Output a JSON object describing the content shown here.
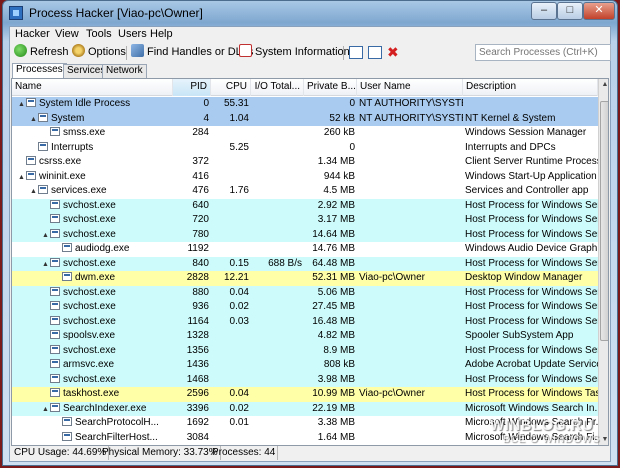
{
  "window": {
    "title": "Process Hacker [Viao-pc\\Owner]",
    "min_label": "–",
    "max_label": "□",
    "close_label": "✕"
  },
  "menu": [
    "Hacker",
    "View",
    "Tools",
    "Users",
    "Help"
  ],
  "toolbar": {
    "refresh": "Refresh",
    "options": "Options",
    "find_handles": "Find Handles or DLLs",
    "system_info": "System Information",
    "search_placeholder": "Search Processes (Ctrl+K)"
  },
  "tabs": [
    "Processes",
    "Services",
    "Network"
  ],
  "columns": [
    "Name",
    "PID",
    "CPU",
    "I/O Total...",
    "Private B...",
    "User Name",
    "Description"
  ],
  "colors": {
    "system_row": "#a9cbef",
    "service_row": "#cdfbfb",
    "own_process_row": "#ffffa8",
    "normal_row": "#ffffff"
  },
  "processes": [
    {
      "name": "System Idle Process",
      "pid": "0",
      "cpu": "55.31",
      "io": "",
      "private": "0",
      "user": "NT AUTHORITY\\SYSTEM",
      "desc": "",
      "depth": 0,
      "toggle": "▲",
      "kind": "system"
    },
    {
      "name": "System",
      "pid": "4",
      "cpu": "1.04",
      "io": "",
      "private": "52 kB",
      "user": "NT AUTHORITY\\SYSTEM",
      "desc": "NT Kernel & System",
      "depth": 1,
      "toggle": "▲",
      "kind": "system"
    },
    {
      "name": "smss.exe",
      "pid": "284",
      "cpu": "",
      "io": "",
      "private": "260 kB",
      "user": "",
      "desc": "Windows Session Manager",
      "depth": 2,
      "toggle": "",
      "kind": "normal"
    },
    {
      "name": "Interrupts",
      "pid": "",
      "cpu": "5.25",
      "io": "",
      "private": "0",
      "user": "",
      "desc": "Interrupts and DPCs",
      "depth": 1,
      "toggle": "",
      "kind": "normal"
    },
    {
      "name": "csrss.exe",
      "pid": "372",
      "cpu": "",
      "io": "",
      "private": "1.34 MB",
      "user": "",
      "desc": "Client Server Runtime Process",
      "depth": 0,
      "toggle": "",
      "kind": "normal"
    },
    {
      "name": "wininit.exe",
      "pid": "416",
      "cpu": "",
      "io": "",
      "private": "944 kB",
      "user": "",
      "desc": "Windows Start-Up Application",
      "depth": 0,
      "toggle": "▲",
      "kind": "normal"
    },
    {
      "name": "services.exe",
      "pid": "476",
      "cpu": "1.76",
      "io": "",
      "private": "4.5 MB",
      "user": "",
      "desc": "Services and Controller app",
      "depth": 1,
      "toggle": "▲",
      "kind": "normal"
    },
    {
      "name": "svchost.exe",
      "pid": "640",
      "cpu": "",
      "io": "",
      "private": "2.92 MB",
      "user": "",
      "desc": "Host Process for Windows Ser...",
      "depth": 2,
      "toggle": "",
      "kind": "service"
    },
    {
      "name": "svchost.exe",
      "pid": "720",
      "cpu": "",
      "io": "",
      "private": "3.17 MB",
      "user": "",
      "desc": "Host Process for Windows Ser...",
      "depth": 2,
      "toggle": "",
      "kind": "service"
    },
    {
      "name": "svchost.exe",
      "pid": "780",
      "cpu": "",
      "io": "",
      "private": "14.64 MB",
      "user": "",
      "desc": "Host Process for Windows Ser...",
      "depth": 2,
      "toggle": "▲",
      "kind": "service"
    },
    {
      "name": "audiodg.exe",
      "pid": "1192",
      "cpu": "",
      "io": "",
      "private": "14.76 MB",
      "user": "",
      "desc": "Windows Audio Device Graph...",
      "depth": 3,
      "toggle": "",
      "kind": "normal"
    },
    {
      "name": "svchost.exe",
      "pid": "840",
      "cpu": "0.15",
      "io": "688 B/s",
      "private": "64.48 MB",
      "user": "",
      "desc": "Host Process for Windows Ser...",
      "depth": 2,
      "toggle": "▲",
      "kind": "service"
    },
    {
      "name": "dwm.exe",
      "pid": "2828",
      "cpu": "12.21",
      "io": "",
      "private": "52.31 MB",
      "user": "Viao-pc\\Owner",
      "desc": "Desktop Window Manager",
      "depth": 3,
      "toggle": "",
      "kind": "own"
    },
    {
      "name": "svchost.exe",
      "pid": "880",
      "cpu": "0.04",
      "io": "",
      "private": "5.06 MB",
      "user": "",
      "desc": "Host Process for Windows Ser...",
      "depth": 2,
      "toggle": "",
      "kind": "service"
    },
    {
      "name": "svchost.exe",
      "pid": "936",
      "cpu": "0.02",
      "io": "",
      "private": "27.45 MB",
      "user": "",
      "desc": "Host Process for Windows Ser...",
      "depth": 2,
      "toggle": "",
      "kind": "service"
    },
    {
      "name": "svchost.exe",
      "pid": "1164",
      "cpu": "0.03",
      "io": "",
      "private": "16.48 MB",
      "user": "",
      "desc": "Host Process for Windows Ser...",
      "depth": 2,
      "toggle": "",
      "kind": "service"
    },
    {
      "name": "spoolsv.exe",
      "pid": "1328",
      "cpu": "",
      "io": "",
      "private": "4.82 MB",
      "user": "",
      "desc": "Spooler SubSystem App",
      "depth": 2,
      "toggle": "",
      "kind": "service"
    },
    {
      "name": "svchost.exe",
      "pid": "1356",
      "cpu": "",
      "io": "",
      "private": "8.9 MB",
      "user": "",
      "desc": "Host Process for Windows Ser...",
      "depth": 2,
      "toggle": "",
      "kind": "service"
    },
    {
      "name": "armsvc.exe",
      "pid": "1436",
      "cpu": "",
      "io": "",
      "private": "808 kB",
      "user": "",
      "desc": "Adobe Acrobat Update Service",
      "depth": 2,
      "toggle": "",
      "kind": "service"
    },
    {
      "name": "svchost.exe",
      "pid": "1468",
      "cpu": "",
      "io": "",
      "private": "3.98 MB",
      "user": "",
      "desc": "Host Process for Windows Ser...",
      "depth": 2,
      "toggle": "",
      "kind": "service"
    },
    {
      "name": "taskhost.exe",
      "pid": "2596",
      "cpu": "0.04",
      "io": "",
      "private": "10.99 MB",
      "user": "Viao-pc\\Owner",
      "desc": "Host Process for Windows Tas...",
      "depth": 2,
      "toggle": "",
      "kind": "own"
    },
    {
      "name": "SearchIndexer.exe",
      "pid": "3396",
      "cpu": "0.02",
      "io": "",
      "private": "22.19 MB",
      "user": "",
      "desc": "Microsoft Windows Search In...",
      "depth": 2,
      "toggle": "▲",
      "kind": "service"
    },
    {
      "name": "SearchProtocolH...",
      "pid": "1692",
      "cpu": "0.01",
      "io": "",
      "private": "3.38 MB",
      "user": "",
      "desc": "Microsoft Windows Search Pr...",
      "depth": 3,
      "toggle": "",
      "kind": "normal"
    },
    {
      "name": "SearchFilterHost...",
      "pid": "3084",
      "cpu": "",
      "io": "",
      "private": "1.64 MB",
      "user": "",
      "desc": "Microsoft Windows Search Fi...",
      "depth": 3,
      "toggle": "",
      "kind": "normal"
    }
  ],
  "status": {
    "cpu": "CPU Usage: 44.69%",
    "memory": "Physical Memory: 33.73%",
    "processes": "Processes: 44"
  },
  "watermark": {
    "main": "WINBLOG.RU",
    "sub": "ВСЁ О WINDOWS"
  }
}
